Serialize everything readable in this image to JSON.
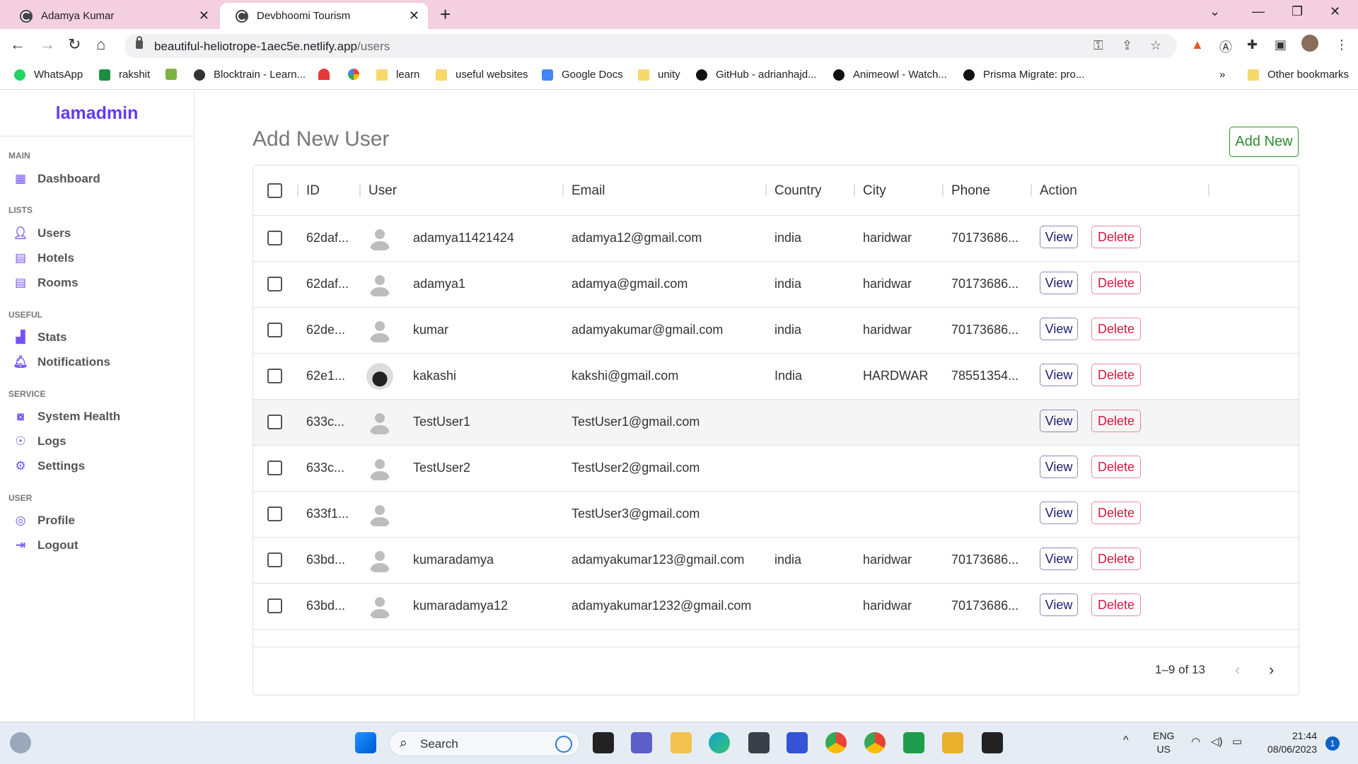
{
  "browser": {
    "tabs": [
      {
        "title": "Adamya Kumar",
        "active": false
      },
      {
        "title": "Devbhoomi Tourism",
        "active": true
      }
    ],
    "url_host": "beautiful-heliotrope-1aec5e.netlify.app",
    "url_path": "/users",
    "bookmarks": [
      {
        "label": "WhatsApp",
        "icon": "whatsapp-icon"
      },
      {
        "label": "rakshit",
        "icon": "meet-icon"
      },
      {
        "label": "",
        "icon": "download-icon"
      },
      {
        "label": "Blocktrain - Learn...",
        "icon": "globe-icon"
      },
      {
        "label": "",
        "icon": "speedometer-icon"
      },
      {
        "label": "",
        "icon": "google-icon"
      },
      {
        "label": "learn",
        "icon": "folder-icon"
      },
      {
        "label": "useful websites",
        "icon": "folder-icon"
      },
      {
        "label": "Google Docs",
        "icon": "docs-icon"
      },
      {
        "label": "unity",
        "icon": "folder-icon"
      },
      {
        "label": "GitHub - adrianhajd...",
        "icon": "github-icon"
      },
      {
        "label": "Animeowl - Watch...",
        "icon": "owl-icon"
      },
      {
        "label": "Prisma Migrate: pro...",
        "icon": "github-icon"
      }
    ],
    "more_bookmarks": "»",
    "other_bookmarks": "Other bookmarks"
  },
  "sidebar": {
    "logo": "lamadmin",
    "sections": [
      {
        "title": "MAIN",
        "items": [
          {
            "label": "Dashboard",
            "icon": "dashboard-icon"
          }
        ]
      },
      {
        "title": "LISTS",
        "items": [
          {
            "label": "Users",
            "icon": "user-icon"
          },
          {
            "label": "Hotels",
            "icon": "store-icon"
          },
          {
            "label": "Rooms",
            "icon": "store-icon"
          }
        ]
      },
      {
        "title": "USEFUL",
        "items": [
          {
            "label": "Stats",
            "icon": "chart-icon"
          },
          {
            "label": "Notifications",
            "icon": "bell-icon"
          }
        ]
      },
      {
        "title": "SERVICE",
        "items": [
          {
            "label": "System Health",
            "icon": "health-icon"
          },
          {
            "label": "Logs",
            "icon": "psychology-icon"
          },
          {
            "label": "Settings",
            "icon": "settings-icon"
          }
        ]
      },
      {
        "title": "USER",
        "items": [
          {
            "label": "Profile",
            "icon": "profile-icon"
          },
          {
            "label": "Logout",
            "icon": "logout-icon"
          }
        ]
      }
    ]
  },
  "main": {
    "title": "Add New User",
    "add_button": "Add New",
    "columns": [
      "ID",
      "User",
      "Email",
      "Country",
      "City",
      "Phone",
      "Action"
    ],
    "rows": [
      {
        "id": "62daf...",
        "user": "adamya11421424",
        "email": "adamya12@gmail.com",
        "country": "india",
        "city": "haridwar",
        "phone": "70173686...",
        "avatar": "default"
      },
      {
        "id": "62daf...",
        "user": "adamya1",
        "email": "adamya@gmail.com",
        "country": "india",
        "city": "haridwar",
        "phone": "70173686...",
        "avatar": "default"
      },
      {
        "id": "62de...",
        "user": "kumar",
        "email": "adamyakumar@gmail.com",
        "country": "india",
        "city": "haridwar",
        "phone": "70173686...",
        "avatar": "default"
      },
      {
        "id": "62e1...",
        "user": "kakashi",
        "email": "kakshi@gmail.com",
        "country": "India",
        "city": "HARDWAR",
        "phone": "78551354...",
        "avatar": "photo"
      },
      {
        "id": "633c...",
        "user": "TestUser1",
        "email": "TestUser1@gmail.com",
        "country": "",
        "city": "",
        "phone": "",
        "avatar": "default"
      },
      {
        "id": "633c...",
        "user": "TestUser2",
        "email": "TestUser2@gmail.com",
        "country": "",
        "city": "",
        "phone": "",
        "avatar": "default"
      },
      {
        "id": "633f1...",
        "user": "",
        "email": "TestUser3@gmail.com",
        "country": "",
        "city": "",
        "phone": "",
        "avatar": "default"
      },
      {
        "id": "63bd...",
        "user": "kumaradamya",
        "email": "adamyakumar123@gmail.com",
        "country": "india",
        "city": "haridwar",
        "phone": "70173686...",
        "avatar": "default"
      },
      {
        "id": "63bd...",
        "user": "kumaradamya12",
        "email": "adamyakumar1232@gmail.com",
        "country": "",
        "city": "haridwar",
        "phone": "70173686...",
        "avatar": "default"
      }
    ],
    "view_label": "View",
    "delete_label": "Delete",
    "pagination": "1–9 of 13"
  },
  "taskbar": {
    "search_placeholder": "Search",
    "lang": "ENG",
    "region": "US",
    "time": "21:44",
    "date": "08/06/2023",
    "notification_count": "1"
  },
  "colors": {
    "accent": "#6439ff",
    "sidebar_icon": "#7451f8",
    "view": "#1c1c6e",
    "delete": "#dc143c",
    "add_new": "#2e8b2e",
    "tabbar": "#f4cfe0"
  }
}
